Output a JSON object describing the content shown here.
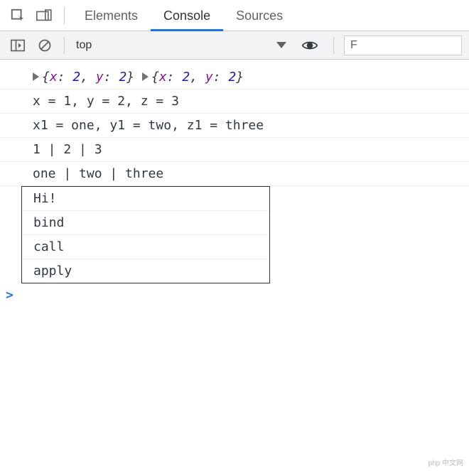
{
  "tabs": {
    "t0": "Elements",
    "t1": "Console",
    "t2": "Sources"
  },
  "subbar": {
    "context": "top",
    "filter_placeholder": "F"
  },
  "logs": {
    "obj1": {
      "x_key": "x",
      "x_val": "2",
      "y_key": "y",
      "y_val": "2"
    },
    "obj2": {
      "x_key": "x",
      "x_val": "2",
      "y_key": "y",
      "y_val": "2"
    },
    "line2": "x = 1, y = 2, z = 3",
    "line3": "x1 = one, y1 = two, z1 = three",
    "line4": "1 | 2 | 3",
    "line5": "one | two | three",
    "group": {
      "g0": "Hi!",
      "g1": "bind",
      "g2": "call",
      "g3": "apply"
    }
  },
  "prompt": ">",
  "watermark": "php 中文网"
}
